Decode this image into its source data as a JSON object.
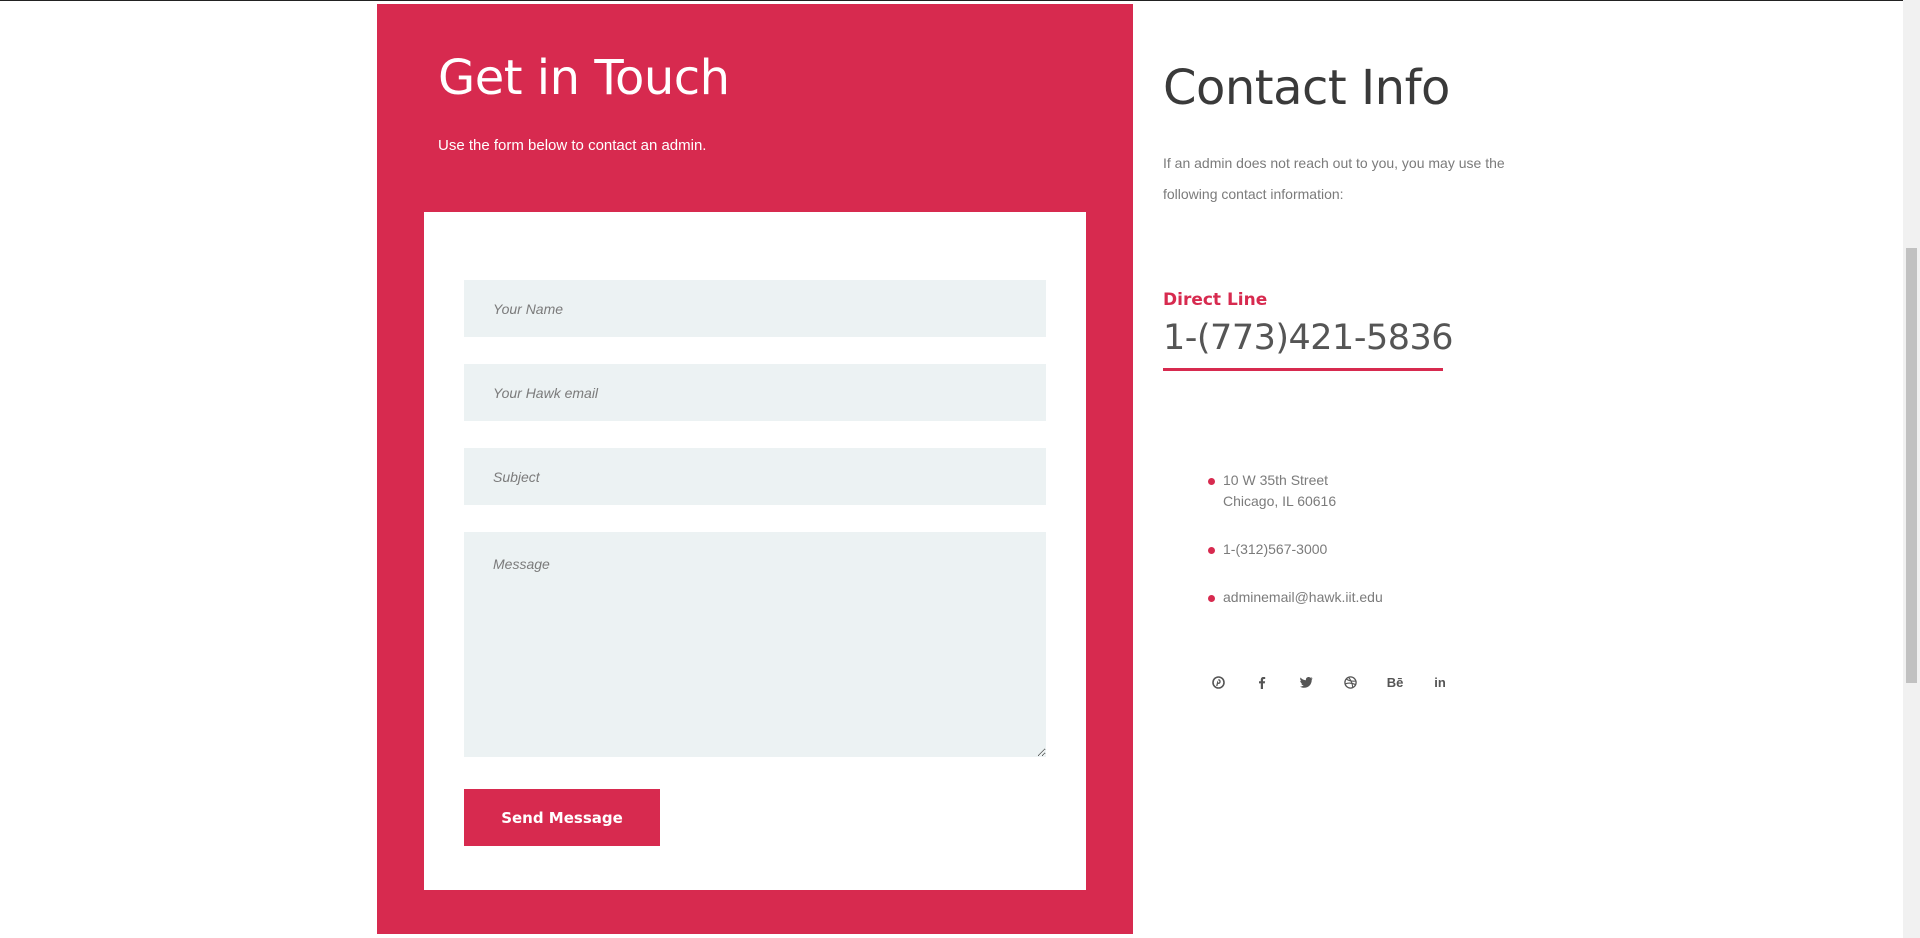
{
  "contact_form": {
    "title": "Get in Touch",
    "subtitle": "Use the form below to contact an admin.",
    "fields": {
      "name_placeholder": "Your Name",
      "email_placeholder": "Your Hawk email",
      "subject_placeholder": "Subject",
      "message_placeholder": "Message"
    },
    "submit_label": "Send Message"
  },
  "contact_info": {
    "title": "Contact Info",
    "description": "If an admin does not reach out to you, you may use the following contact information:",
    "direct_line_label": "Direct Line",
    "direct_line_number": "1-(773)421-5836",
    "address_line1": "10 W 35th Street",
    "address_line2": "Chicago, IL 60616",
    "phone": "1-(312)567-3000",
    "email": "adminemail@hawk.iit.edu",
    "social": {
      "pinterest": "pinterest-icon",
      "facebook": "facebook-icon",
      "twitter": "twitter-icon",
      "dribbble": "dribbble-icon",
      "behance": "Bē",
      "linkedin": "in"
    }
  },
  "colors": {
    "accent": "#d72a4f",
    "field_bg": "#ecf2f3",
    "heading_dark": "#3a3a3a",
    "muted_text": "#7b7b7b"
  }
}
